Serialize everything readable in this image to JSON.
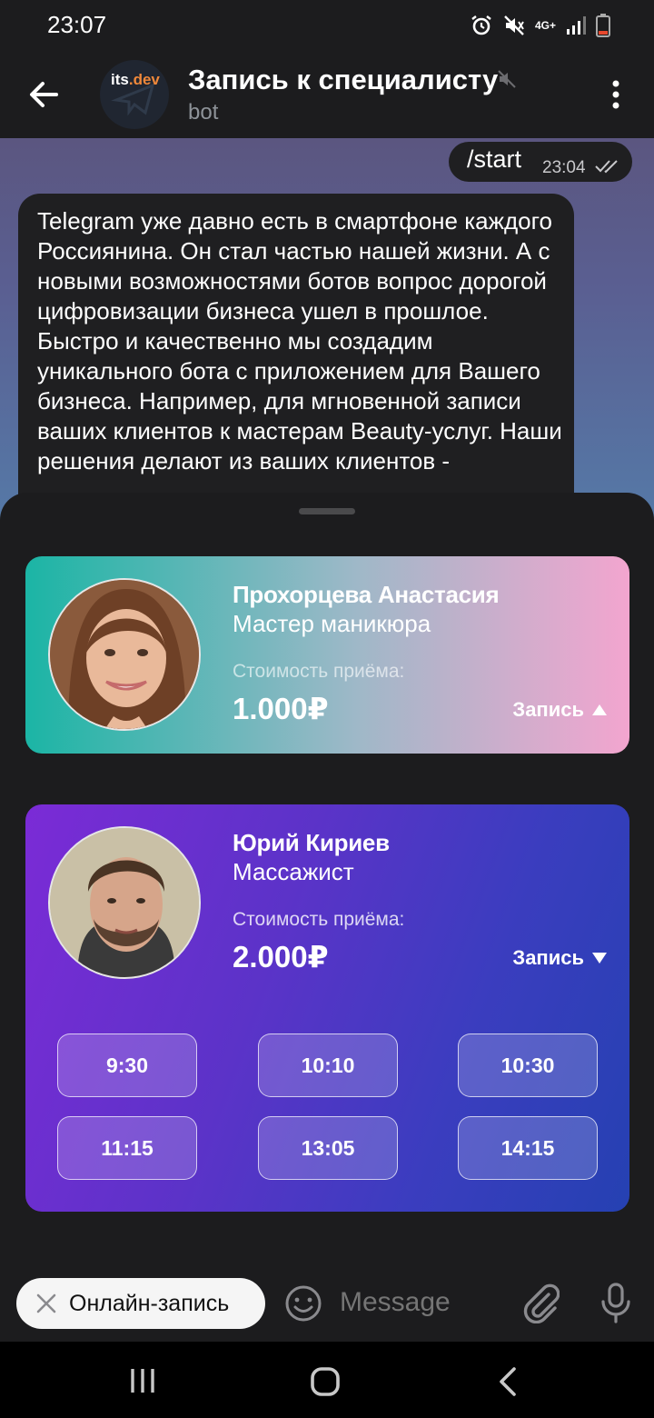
{
  "status_bar": {
    "time": "23:07",
    "network": "4G+"
  },
  "header": {
    "avatar_text_1": "its",
    "avatar_text_2": ".dev",
    "title": "Запись к специалисту",
    "subtitle": "bot"
  },
  "chat": {
    "outgoing": {
      "text": "/start",
      "time": "23:04"
    },
    "incoming": {
      "text": "Telegram уже давно есть в смартфоне каждого Россиянина. Он стал частью нашей жизни. А с новыми возможностями ботов вопрос дорогой цифровизации бизнеса ушел в прошлое. Быстро и качественно мы создадим уникального бота с приложением для Вашего бизнеса. Например, для мгновенной записи ваших клиентов к мастерам Beauty-услуг. Наши решения делают из ваших клиентов -"
    }
  },
  "specialists": [
    {
      "name": "Прохорцева Анастасия",
      "role": "Мастер маникюра",
      "price_label": "Стоимость приёма:",
      "price": "1.000₽",
      "book_label": "Запись",
      "expanded": false
    },
    {
      "name": "Юрий Кириев",
      "role": "Массажист",
      "price_label": "Стоимость приёма:",
      "price": "2.000₽",
      "book_label": "Запись",
      "expanded": true,
      "slots": [
        "9:30",
        "10:10",
        "10:30",
        "11:15",
        "13:05",
        "14:15"
      ]
    }
  ],
  "input_bar": {
    "keyboard_button": "Онлайн-запись",
    "placeholder": "Message"
  },
  "colors": {
    "accent_orange": "#f0883a",
    "card1_start": "#1bb5a5",
    "card1_end": "#f3a5cf",
    "card2_start": "#7b2bd6",
    "card2_end": "#2541b2"
  }
}
